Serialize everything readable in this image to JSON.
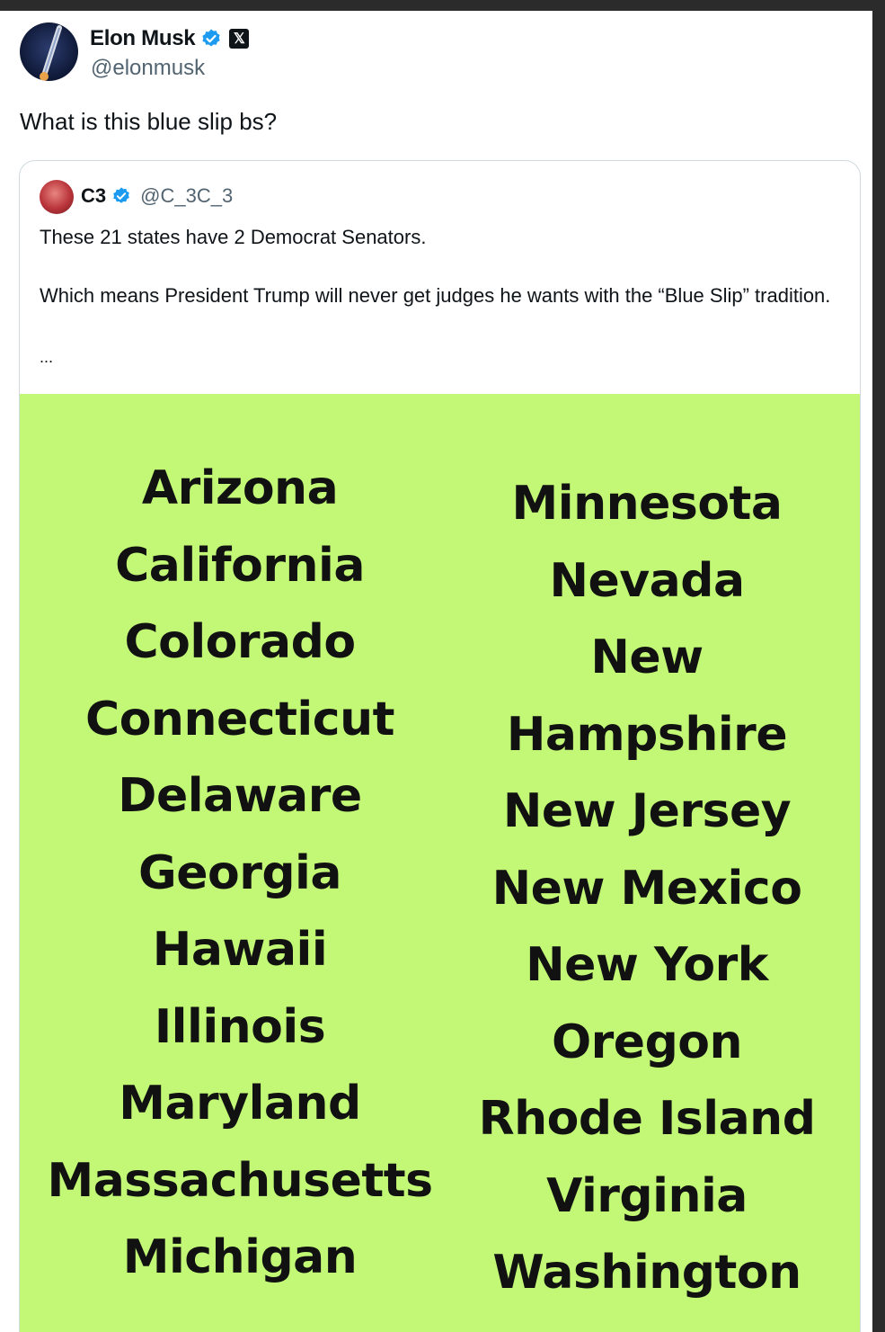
{
  "tweet": {
    "author_name": "Elon Musk",
    "author_handle": "@elonmusk",
    "verified_icon": "verified-badge-icon",
    "affiliate_icon": "x-logo-icon",
    "affiliate_label": "𝕏",
    "text": "What is this blue slip bs?"
  },
  "quoted_tweet": {
    "author_name": "C3",
    "author_handle": "@C_3C_3",
    "text_line1": "These 21 states have 2 Democrat Senators.",
    "text_line2": "Which means President Trump will never get judges he wants with the “Blue Slip” tradition.",
    "ellipsis": "...",
    "image": {
      "background_color": "#c2f876",
      "left_column": [
        "Arizona",
        "California",
        "Colorado",
        "Connecticut",
        "Delaware",
        "Georgia",
        "Hawaii",
        "Illinois",
        "Maryland",
        "Massachusetts",
        "Michigan"
      ],
      "right_column": [
        "Minnesota",
        "Nevada",
        "New",
        "Hampshire",
        "New Jersey",
        "New Mexico",
        "New York",
        "Oregon",
        "Rhode Island",
        "Virginia",
        "Washington"
      ]
    }
  },
  "colors": {
    "verified_blue": "#1d9bf0",
    "text_primary": "#0f1419",
    "text_secondary": "#536471"
  }
}
